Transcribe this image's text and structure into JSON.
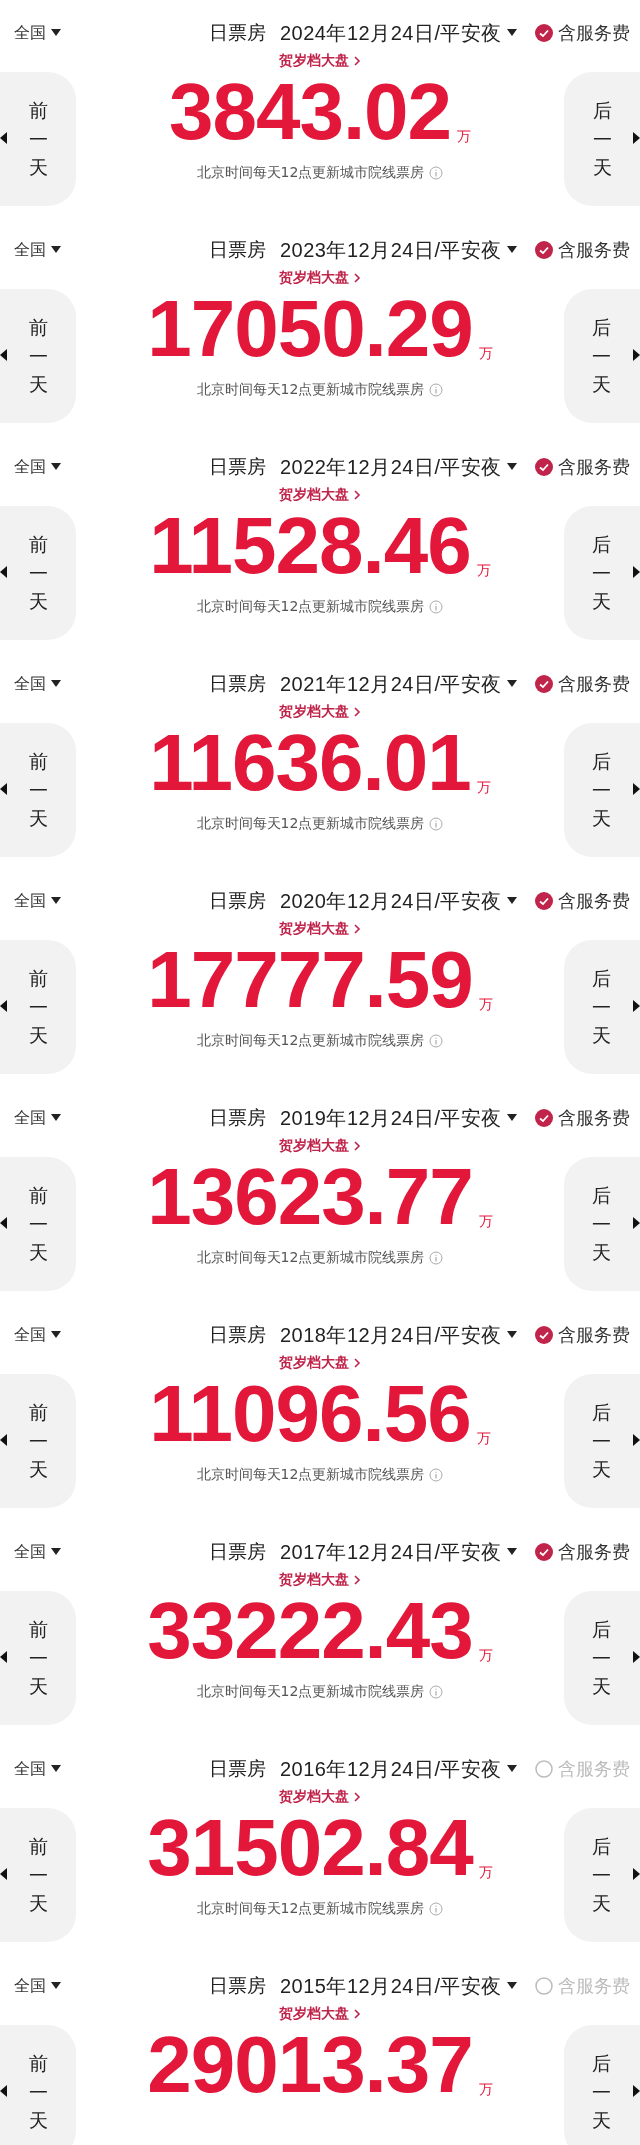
{
  "panels": [
    {
      "region": "全国",
      "title": "日票房",
      "date": "2024年12月24日/平安夜",
      "fee": {
        "label": "含服务费",
        "checked": true
      },
      "link": "贺岁档大盘",
      "amount": "3843.02",
      "unit": "万",
      "note": "北京时间每天12点更新城市院线票房",
      "prev": "前一天",
      "next": "后一天"
    },
    {
      "region": "全国",
      "title": "日票房",
      "date": "2023年12月24日/平安夜",
      "fee": {
        "label": "含服务费",
        "checked": true
      },
      "link": "贺岁档大盘",
      "amount": "17050.29",
      "unit": "万",
      "note": "北京时间每天12点更新城市院线票房",
      "prev": "前一天",
      "next": "后一天"
    },
    {
      "region": "全国",
      "title": "日票房",
      "date": "2022年12月24日/平安夜",
      "fee": {
        "label": "含服务费",
        "checked": true
      },
      "link": "贺岁档大盘",
      "amount": "11528.46",
      "unit": "万",
      "note": "北京时间每天12点更新城市院线票房",
      "prev": "前一天",
      "next": "后一天"
    },
    {
      "region": "全国",
      "title": "日票房",
      "date": "2021年12月24日/平安夜",
      "fee": {
        "label": "含服务费",
        "checked": true
      },
      "link": "贺岁档大盘",
      "amount": "11636.01",
      "unit": "万",
      "note": "北京时间每天12点更新城市院线票房",
      "prev": "前一天",
      "next": "后一天"
    },
    {
      "region": "全国",
      "title": "日票房",
      "date": "2020年12月24日/平安夜",
      "fee": {
        "label": "含服务费",
        "checked": true
      },
      "link": "贺岁档大盘",
      "amount": "17777.59",
      "unit": "万",
      "note": "北京时间每天12点更新城市院线票房",
      "prev": "前一天",
      "next": "后一天"
    },
    {
      "region": "全国",
      "title": "日票房",
      "date": "2019年12月24日/平安夜",
      "fee": {
        "label": "含服务费",
        "checked": true
      },
      "link": "贺岁档大盘",
      "amount": "13623.77",
      "unit": "万",
      "note": "北京时间每天12点更新城市院线票房",
      "prev": "前一天",
      "next": "后一天"
    },
    {
      "region": "全国",
      "title": "日票房",
      "date": "2018年12月24日/平安夜",
      "fee": {
        "label": "含服务费",
        "checked": true
      },
      "link": "贺岁档大盘",
      "amount": "11096.56",
      "unit": "万",
      "note": "北京时间每天12点更新城市院线票房",
      "prev": "前一天",
      "next": "后一天"
    },
    {
      "region": "全国",
      "title": "日票房",
      "date": "2017年12月24日/平安夜",
      "fee": {
        "label": "含服务费",
        "checked": true
      },
      "link": "贺岁档大盘",
      "amount": "33222.43",
      "unit": "万",
      "note": "北京时间每天12点更新城市院线票房",
      "prev": "前一天",
      "next": "后一天"
    },
    {
      "region": "全国",
      "title": "日票房",
      "date": "2016年12月24日/平安夜",
      "fee": {
        "label": "含服务费",
        "checked": false
      },
      "link": "贺岁档大盘",
      "amount": "31502.84",
      "unit": "万",
      "note": "北京时间每天12点更新城市院线票房",
      "prev": "前一天",
      "next": "后一天"
    },
    {
      "region": "全国",
      "title": "日票房",
      "date": "2015年12月24日/平安夜",
      "fee": {
        "label": "含服务费",
        "checked": false
      },
      "link": "贺岁档大盘",
      "amount": "29013.37",
      "unit": "万",
      "prev": "前一天",
      "next": "后一天"
    }
  ]
}
